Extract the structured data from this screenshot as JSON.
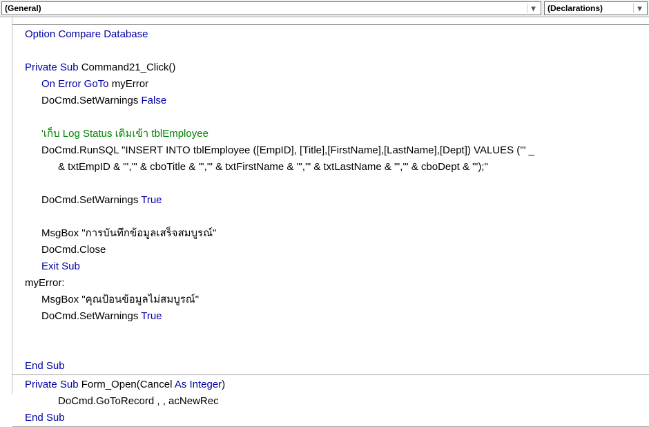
{
  "topbar": {
    "left_dropdown": "(General)",
    "right_dropdown": "(Declarations)"
  },
  "code": {
    "line1": "Option Compare Database",
    "sub1": {
      "decl_kw": "Private Sub ",
      "decl_name": "Command21_Click()",
      "onerr_kw": "On Error GoTo ",
      "onerr_lbl": "myError",
      "setwarn1a": "DoCmd.SetWarnings ",
      "setwarn1b": "False",
      "comment": "'เก็บ Log Status เดิมเข้า tblEmployee",
      "runsql": "DoCmd.RunSQL \"INSERT INTO tblEmployee ([EmpID], [Title],[FirstName],[LastName],[Dept]) VALUES ('\" _",
      "runsql2": "& txtEmpID & \"','\" & cboTitle & \"','\" & txtFirstName & \"','\" & txtLastName & \"','\" & cboDept & \"');\"",
      "setwarn2a": "DoCmd.SetWarnings ",
      "setwarn2b": "True",
      "msg1": "MsgBox \"การบันทึกข้อมูลเสร็จสมบูรณ์\"",
      "close": "DoCmd.Close",
      "exit": "Exit Sub",
      "label": "myError:",
      "msg2": "MsgBox \"คุณป้อนข้อมูลไม่สมบูรณ์\"",
      "setwarn3a": "DoCmd.SetWarnings ",
      "setwarn3b": "True",
      "end": "End Sub"
    },
    "sub2": {
      "decl_kw1": "Private Sub ",
      "decl_name": "Form_Open(Cancel ",
      "decl_kw2": "As Integer",
      "decl_close": ")",
      "body": "DoCmd.GoToRecord , , acNewRec",
      "end": "End Sub"
    }
  }
}
